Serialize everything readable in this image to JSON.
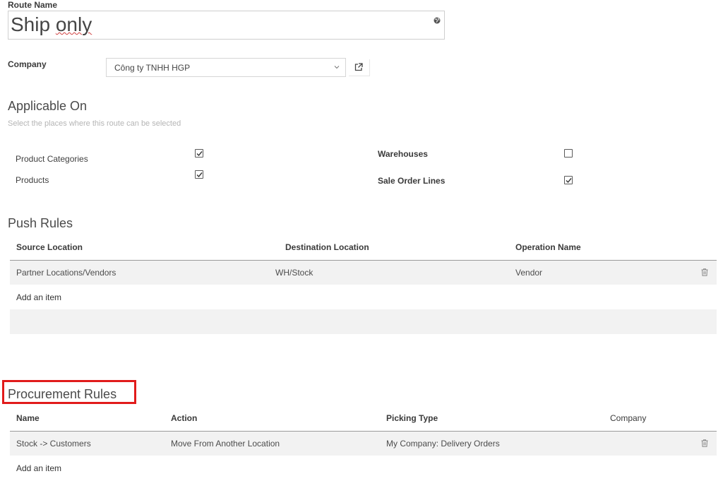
{
  "route_name": {
    "label": "Route Name",
    "value_main": "Ship ",
    "value_spell": "only"
  },
  "company": {
    "label": "Company",
    "value": "Công ty TNHH HGP"
  },
  "applicable": {
    "title": "Applicable On",
    "help": "Select the places where this route can be selected",
    "options": [
      {
        "label": "Product Categories",
        "checked": true
      },
      {
        "label": "Products",
        "checked": true
      },
      {
        "label": "Warehouses",
        "checked": false
      },
      {
        "label": "Sale Order Lines",
        "checked": true
      }
    ]
  },
  "push_rules": {
    "title": "Push Rules",
    "headers": [
      "Source Location",
      "Destination Location",
      "Operation Name"
    ],
    "rows": [
      [
        "Partner Locations/Vendors",
        "WH/Stock",
        "Vendor"
      ]
    ],
    "add_item": "Add an item"
  },
  "procurement_rules": {
    "title": "Procurement Rules",
    "headers": [
      "Name",
      "Action",
      "Picking Type",
      "Company"
    ],
    "rows": [
      [
        "Stock -> Customers",
        "Move From Another Location",
        "My Company: Delivery Orders",
        ""
      ]
    ],
    "add_item": "Add an item"
  },
  "colors": {
    "highlight": "#e11b1b",
    "row_bg": "#f2f2f2"
  }
}
